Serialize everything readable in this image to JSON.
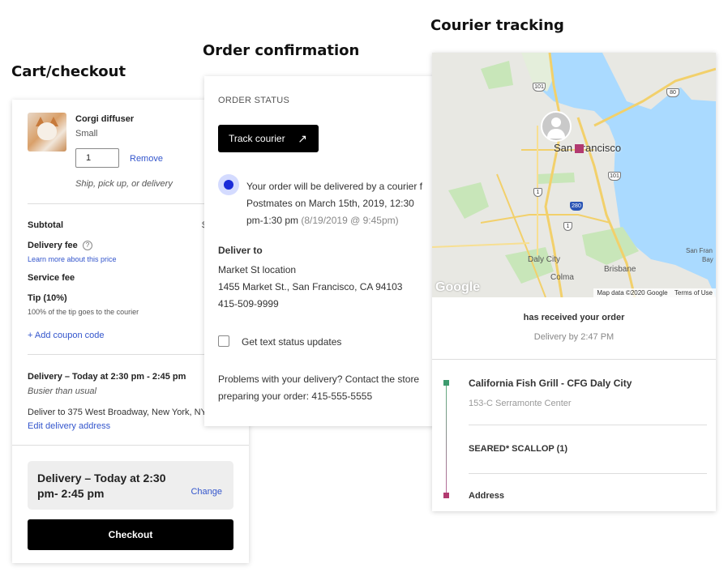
{
  "titles": {
    "cart": "Cart/checkout",
    "order": "Order confirmation",
    "courier": "Courier tracking"
  },
  "cart": {
    "item_name": "Corgi diffuser",
    "item_variant": "Small",
    "quantity": "1",
    "remove_label": "Remove",
    "fulfillment_note": "Ship, pick up, or delivery",
    "subtotal_label": "Subtotal",
    "delivery_fee_label": "Delivery fee",
    "learn_more_link": "Learn more about this price",
    "service_fee_label": "Service fee",
    "tip_label": "Tip (10%)",
    "tip_note": "100% of the tip goes to the courier",
    "coupon_link": "+ Add coupon code",
    "delivery_window": "Delivery – Today at 2:30 pm - 2:45 pm",
    "busy_note": "Busier than usual",
    "deliver_to": "Deliver to 375 West Broadway, New York, NY",
    "edit_address_link": "Edit delivery address",
    "delivery_box_text": "Delivery – Today at 2:30 pm- 2:45 pm",
    "change_label": "Change",
    "checkout_label": "Checkout",
    "subtotal_value_partial": "$"
  },
  "order": {
    "status_heading": "ORDER STATUS",
    "track_label": "Track courier",
    "track_icon": "arrow-up-right-icon",
    "status_line1": "Your order will be delivered by a courier f",
    "status_line2": "Postmates on March 15th, 2019, 12:30",
    "status_line3": "pm-1:30 pm",
    "status_timestamp": "(8/19/2019 @ 9:45pm)",
    "deliver_to_heading": "Deliver to",
    "location_name": "Market St location",
    "address": "1455 Market St., San Francisco, CA 94103",
    "phone": "415-509-9999",
    "text_updates_label": "Get text status updates",
    "problems_line1": "Problems with your delivery? Contact the store",
    "problems_line2": "preparing your order: 415-555-5555"
  },
  "courier": {
    "map": {
      "city_label": "San Francisco",
      "daly_city": "Daly City",
      "colma": "Colma",
      "brisbane": "Brisbane",
      "sf_bay": "San Fran",
      "sf_bay2": "Bay",
      "shield_101a": "101",
      "shield_101b": "101",
      "shield_1a": "1",
      "shield_1b": "1",
      "shield_280": "280",
      "shield_80": "80",
      "google": "Google",
      "attribution": "Map data ©2020 Google",
      "terms": "Terms of Use"
    },
    "received_text": "has received your order",
    "delivery_by": "Delivery by 2:47 PM",
    "store_name": "California Fish Grill - CFG Daly City",
    "store_address": "153-C Serramonte Center",
    "item": "SEARED* SCALLOP (1)",
    "address_label": "Address"
  },
  "colors": {
    "accent_blue": "#1a2bd8",
    "link_blue": "#3355cc",
    "pickup_green": "#3d9b6e",
    "dropoff_magenta": "#b23a70"
  }
}
